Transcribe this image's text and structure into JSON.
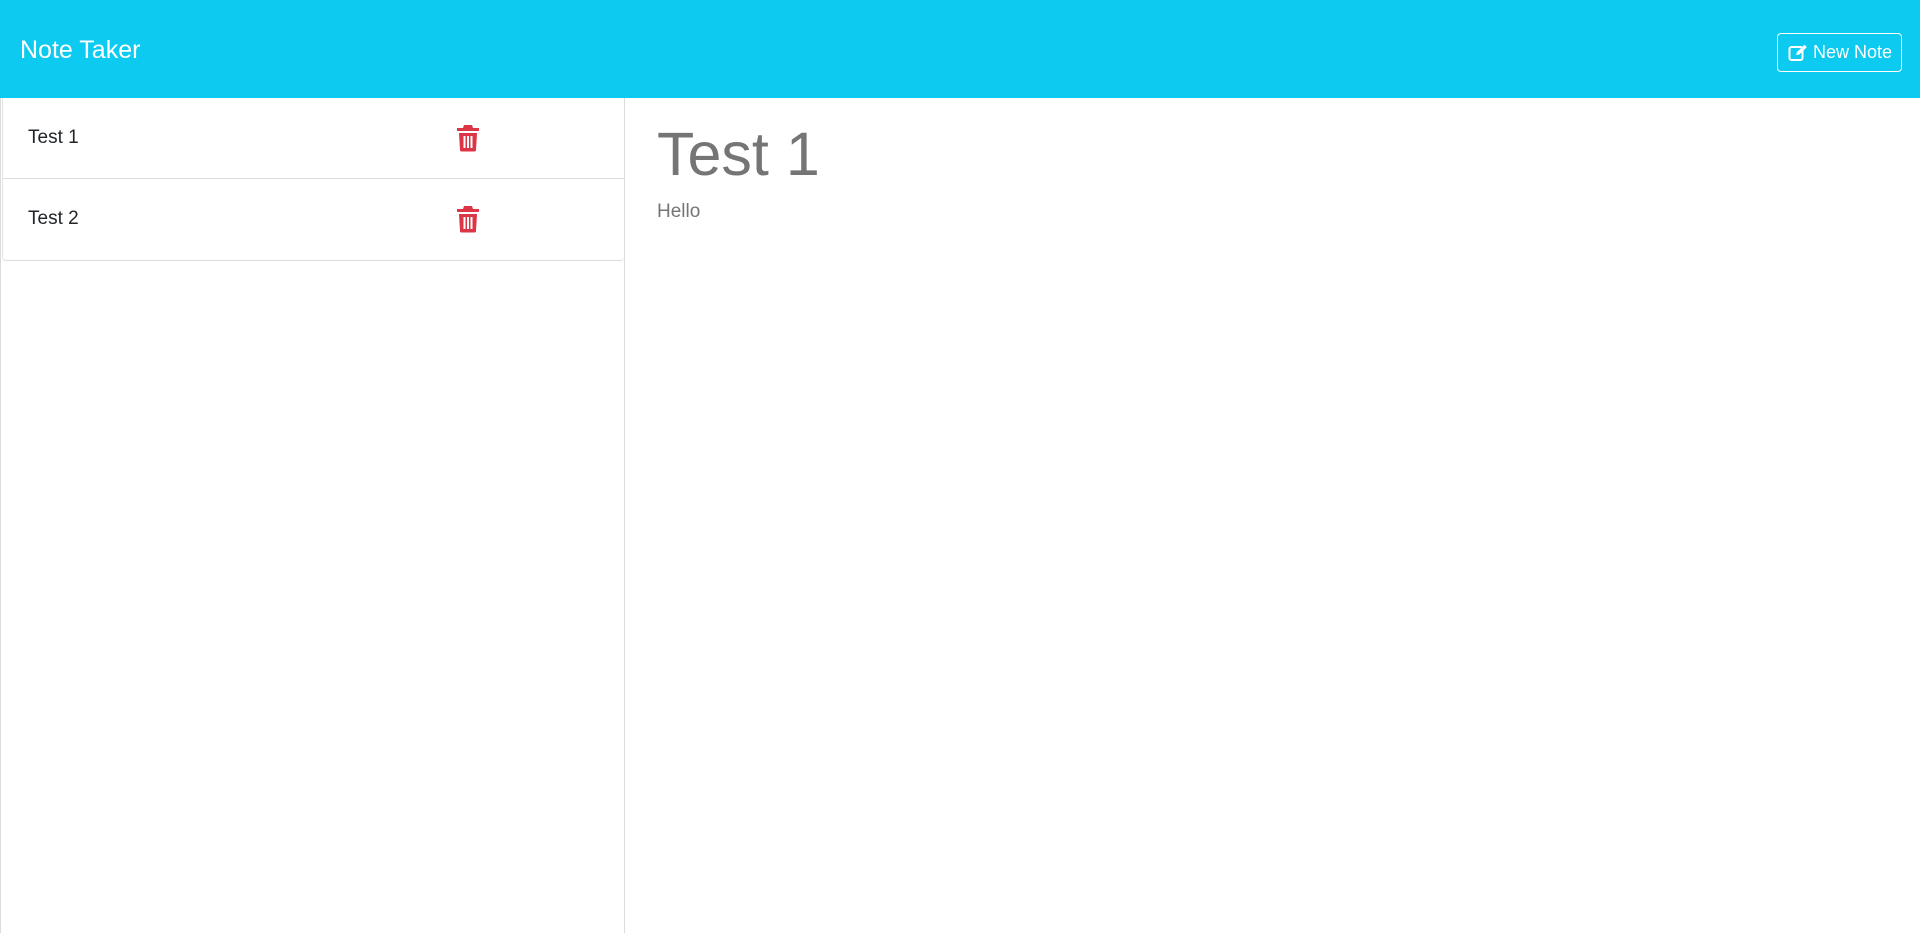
{
  "navbar": {
    "title": "Note Taker",
    "new_note_label": "New Note",
    "new_note_icon": "edit-icon",
    "background": "#0dcaf0"
  },
  "notes": [
    {
      "title": "Test 1"
    },
    {
      "title": "Test 2"
    }
  ],
  "delete_icon": "trash-icon",
  "delete_color": "#dc3545",
  "active_note": {
    "title": "Test 1",
    "text": "Hello"
  }
}
